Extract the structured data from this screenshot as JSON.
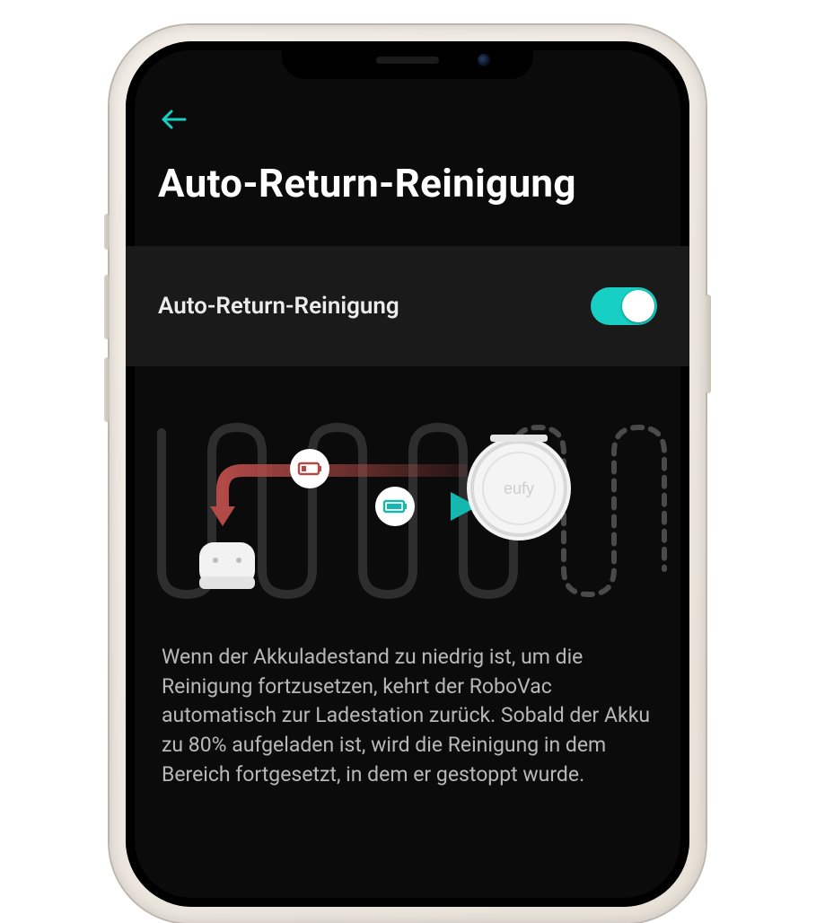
{
  "header": {
    "title": "Auto-Return-Reinigung"
  },
  "setting": {
    "label": "Auto-Return-Reinigung",
    "enabled": true
  },
  "illustration": {
    "robot_label": "eufy"
  },
  "description": "Wenn der Akkuladestand zu niedrig ist, um die Reinigung fortzusetzen, kehrt der RoboVac automatisch zur Ladestation zurück. Sobald der Akku zu 80% aufgeladen ist, wird die Reinigung in dem Bereich fortgesetzt, in dem er gestoppt wurde.",
  "colors": {
    "accent": "#18cfc4",
    "return_arrow": "#b24a47"
  }
}
